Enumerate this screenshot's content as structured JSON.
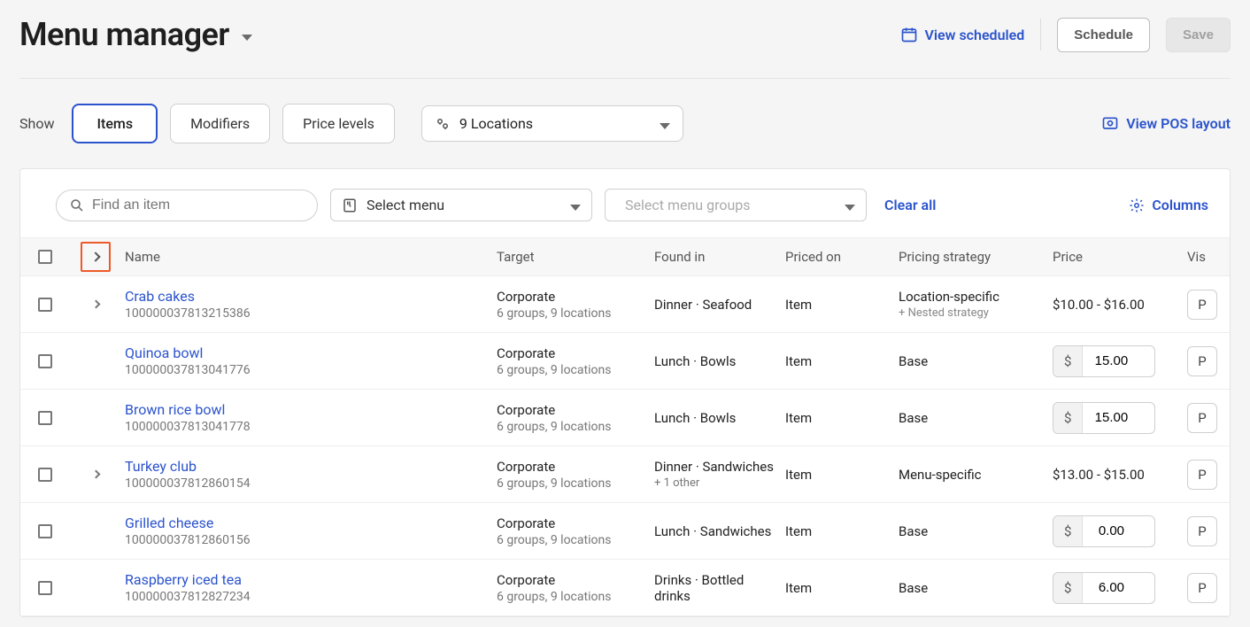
{
  "header": {
    "title": "Menu manager",
    "view_scheduled": "View scheduled",
    "schedule": "Schedule",
    "save": "Save"
  },
  "filters": {
    "show_label": "Show",
    "tabs": {
      "items": "Items",
      "modifiers": "Modifiers",
      "price_levels": "Price levels"
    },
    "locations_label": "9 Locations",
    "view_pos": "View POS layout"
  },
  "toolbar": {
    "search_placeholder": "Find an item",
    "select_menu": "Select menu",
    "select_groups_placeholder": "Select menu groups",
    "clear_all": "Clear all",
    "columns": "Columns"
  },
  "table": {
    "headers": {
      "name": "Name",
      "target": "Target",
      "found": "Found in",
      "priced": "Priced on",
      "strategy": "Pricing strategy",
      "price": "Price",
      "visibility": "Vis"
    },
    "rows": [
      {
        "name": "Crab cakes",
        "id": "100000037813215386",
        "expandable": true,
        "target": "Corporate",
        "target_sub": "6 groups, 9 locations",
        "found": "Dinner · Seafood",
        "found_sub": "",
        "priced": "Item",
        "strategy": "Location-specific",
        "strategy_sub": "+ Nested strategy",
        "price_text": "$10.00 - $16.00",
        "price_input": null,
        "vis": "P"
      },
      {
        "name": "Quinoa bowl",
        "id": "100000037813041776",
        "expandable": false,
        "target": "Corporate",
        "target_sub": "6 groups, 9 locations",
        "found": "Lunch · Bowls",
        "found_sub": "",
        "priced": "Item",
        "strategy": "Base",
        "strategy_sub": "",
        "price_text": null,
        "price_input": "15.00",
        "vis": "P"
      },
      {
        "name": "Brown rice bowl",
        "id": "100000037813041778",
        "expandable": false,
        "target": "Corporate",
        "target_sub": "6 groups, 9 locations",
        "found": "Lunch · Bowls",
        "found_sub": "",
        "priced": "Item",
        "strategy": "Base",
        "strategy_sub": "",
        "price_text": null,
        "price_input": "15.00",
        "vis": "P"
      },
      {
        "name": "Turkey club",
        "id": "100000037812860154",
        "expandable": true,
        "target": "Corporate",
        "target_sub": "6 groups, 9 locations",
        "found": "Dinner · Sandwiches",
        "found_sub": "+ 1 other",
        "priced": "Item",
        "strategy": "Menu-specific",
        "strategy_sub": "",
        "price_text": "$13.00 - $15.00",
        "price_input": null,
        "vis": "P"
      },
      {
        "name": "Grilled cheese",
        "id": "100000037812860156",
        "expandable": false,
        "target": "Corporate",
        "target_sub": "6 groups, 9 locations",
        "found": "Lunch · Sandwiches",
        "found_sub": "",
        "priced": "Item",
        "strategy": "Base",
        "strategy_sub": "",
        "price_text": null,
        "price_input": "0.00",
        "vis": "P"
      },
      {
        "name": "Raspberry iced tea",
        "id": "100000037812827234",
        "expandable": false,
        "target": "Corporate",
        "target_sub": "6 groups, 9 locations",
        "found": "Drinks · Bottled drinks",
        "found_sub": "",
        "priced": "Item",
        "strategy": "Base",
        "strategy_sub": "",
        "price_text": null,
        "price_input": "6.00",
        "vis": "P"
      }
    ]
  }
}
